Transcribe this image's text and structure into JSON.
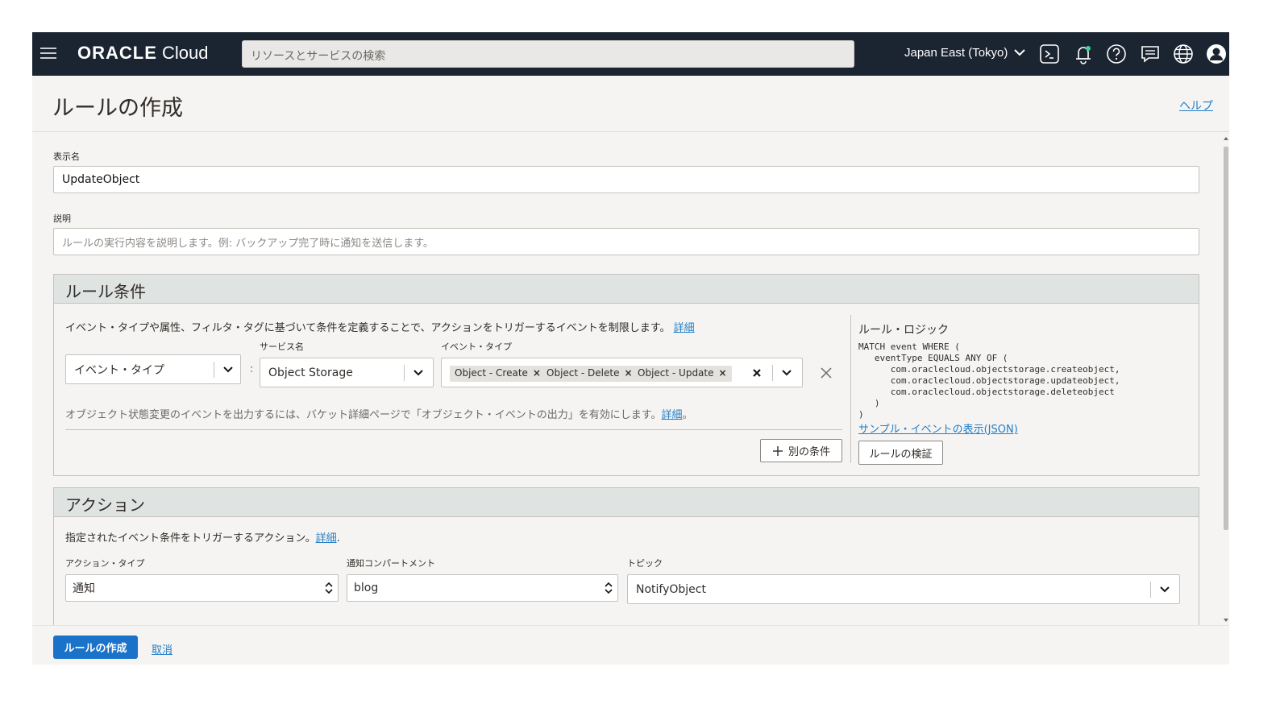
{
  "topbar": {
    "logo_brand": "ORACLE",
    "logo_product": "Cloud",
    "search_placeholder": "リソースとサービスの検索",
    "region": "Japan East (Tokyo)",
    "icons": [
      "menu-icon",
      "cloud-shell-icon",
      "bell-icon",
      "help-icon",
      "chat-icon",
      "globe-icon",
      "user-icon"
    ]
  },
  "page": {
    "title": "ルールの作成",
    "help_link": "ヘルプ"
  },
  "form": {
    "display_name_label": "表示名",
    "display_name_value": "UpdateObject",
    "description_label": "説明",
    "description_placeholder": "ルールの実行内容を説明します。例: バックアップ完了時に通知を送信します。"
  },
  "rule_conditions": {
    "title": "ルール条件",
    "intro": "イベント・タイプや属性、フィルタ・タグに基づいて条件を定義することで、アクションをトリガーするイベントを制限します。",
    "intro_link": "詳細",
    "condition_type": "イベント・タイプ",
    "service_name_label": "サービス名",
    "service_name_value": "Object Storage",
    "event_type_label": "イベント・タイプ",
    "event_types": [
      "Object - Create",
      "Object - Delete",
      "Object - Update"
    ],
    "separator": ":",
    "note": "オブジェクト状態変更のイベントを出力するには、バケット詳細ページで「オブジェクト・イベントの出力」を有効にします。",
    "note_link": "詳細",
    "note_end": "。",
    "add_condition_button": "別の条件"
  },
  "rule_logic": {
    "title": "ルール・ロジック",
    "code": "MATCH event WHERE (\n   eventType EQUALS ANY OF (\n      com.oraclecloud.objectstorage.createobject,\n      com.oraclecloud.objectstorage.updateobject,\n      com.oraclecloud.objectstorage.deleteobject\n   )\n)",
    "sample_link": "サンプル・イベントの表示(JSON)",
    "validate_button": "ルールの検証"
  },
  "actions": {
    "title": "アクション",
    "intro": "指定されたイベント条件をトリガーするアクション。",
    "intro_link": "詳細",
    "intro_end": ".",
    "action_type_label": "アクション・タイプ",
    "action_type_value": "通知",
    "compartment_label": "通知コンパートメント",
    "compartment_value": "blog",
    "topic_label": "トピック",
    "topic_value": "NotifyObject"
  },
  "footer": {
    "create_button": "ルールの作成",
    "cancel_link": "取消"
  }
}
